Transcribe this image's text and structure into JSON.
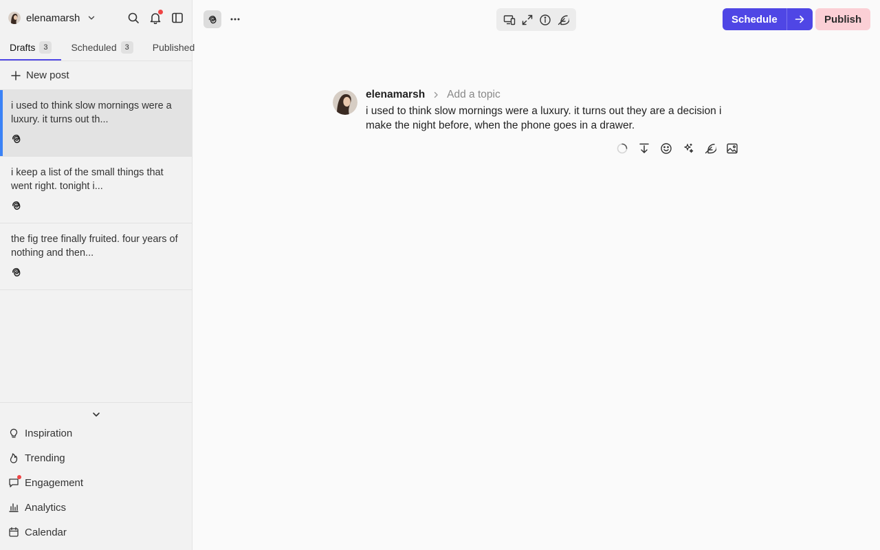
{
  "sidebar": {
    "account": {
      "name": "elenamarsh",
      "avatar": "avatar-icon"
    },
    "top_icons": [
      "search-icon",
      "bell-icon",
      "sidebar-toggle-icon"
    ],
    "tabs": [
      {
        "label": "Drafts",
        "count": "3",
        "active": true
      },
      {
        "label": "Scheduled",
        "count": "3",
        "active": false
      },
      {
        "label": "Published",
        "count": "",
        "active": false
      }
    ],
    "new_post_label": "New post",
    "drafts": [
      {
        "text": "i used to think slow mornings were a luxury. it turns out th...",
        "platform": "threads-icon",
        "selected": true
      },
      {
        "text": "i keep a list of the small things that went right. tonight i...",
        "platform": "threads-icon",
        "selected": false
      },
      {
        "text": "the fig tree finally fruited. four years of nothing and then...",
        "platform": "threads-icon",
        "selected": false
      }
    ],
    "nav": [
      {
        "label": "Inspiration",
        "icon": "lightbulb-icon"
      },
      {
        "label": "Trending",
        "icon": "flame-icon"
      },
      {
        "label": "Engagement",
        "icon": "chat-icon",
        "notification": true
      },
      {
        "label": "Analytics",
        "icon": "bar-chart-icon"
      },
      {
        "label": "Calendar",
        "icon": "calendar-icon"
      }
    ]
  },
  "header": {
    "schedule_label": "Schedule",
    "publish_label": "Publish",
    "accent": "#4f46e5",
    "publish_bg": "#fbcfd5"
  },
  "post": {
    "username": "elenamarsh",
    "topic_placeholder": "Add a topic",
    "body": "i used to think slow mornings were a luxury. it turns out they are a decision i make the night before, when the phone goes in a drawer."
  }
}
